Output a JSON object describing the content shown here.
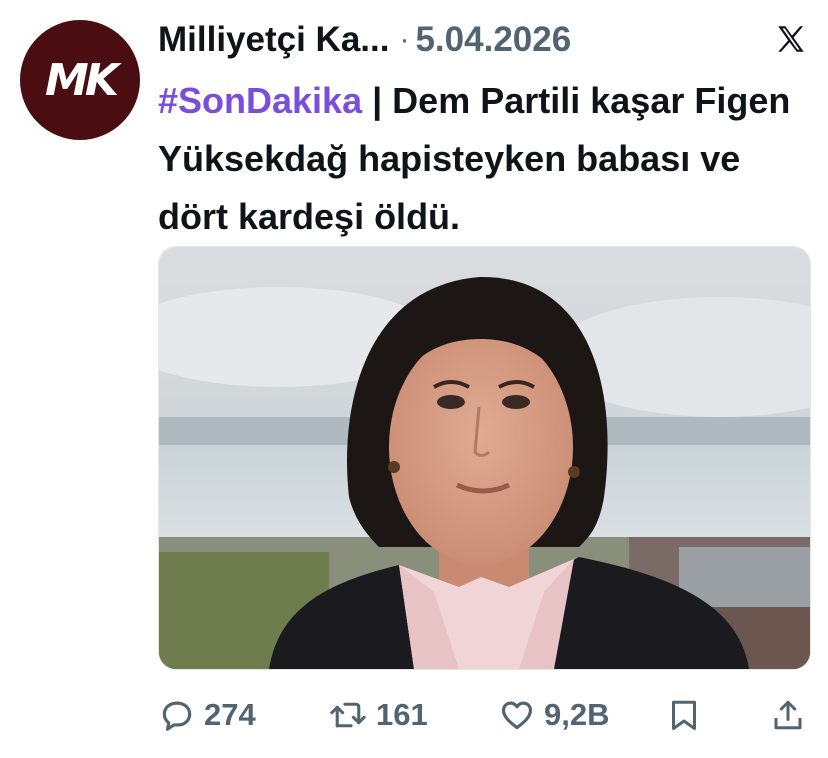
{
  "tweet": {
    "avatar_text": "MK",
    "author": "Milliyetçi Ka...",
    "separator": "·",
    "date": "5.04.2026",
    "hashtag": "#SonDakika",
    "text": " | Dem Partili kaşar Figen Yüksekdağ hapisteyken babası ve dört kardeşi öldü."
  },
  "actions": {
    "replies": "274",
    "retweets": "161",
    "likes": "9,2B"
  },
  "colors": {
    "hashtag": "#7b4ddb",
    "avatar_bg": "#4a0e12",
    "muted": "#536471"
  },
  "icons": [
    "x-logo-icon",
    "reply-icon",
    "retweet-icon",
    "like-icon",
    "bookmark-icon",
    "share-icon"
  ]
}
